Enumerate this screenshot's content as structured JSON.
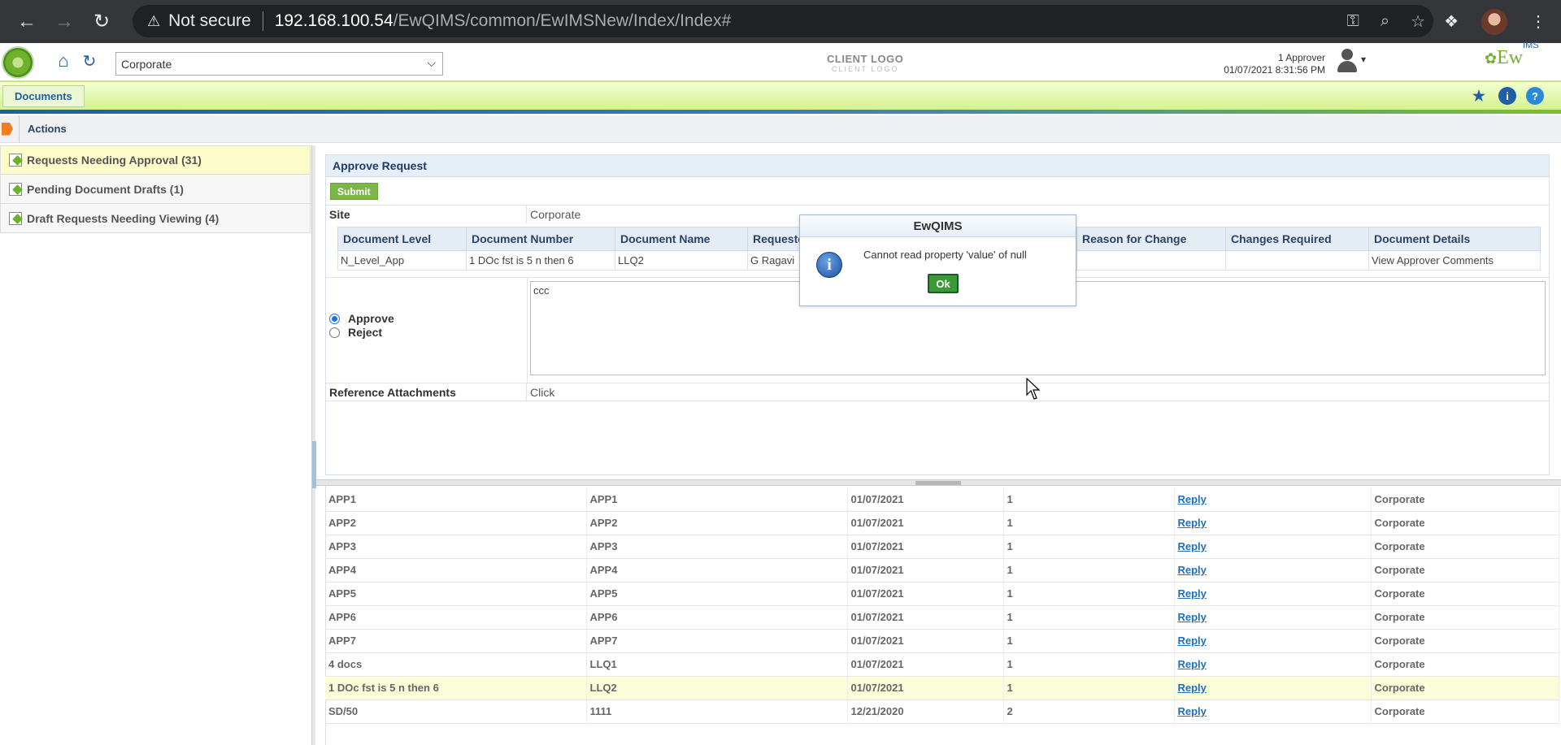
{
  "browser": {
    "not_secure_label": "Not secure",
    "url_host": "192.168.100.54",
    "url_path": "/EwQIMS/common/EwIMSNew/Index/Index#"
  },
  "header": {
    "site_selected": "Corporate",
    "client_logo": "CLIENT LOGO",
    "client_logo_mirror": "CLIENT LOGO",
    "user_role": "1 Approver",
    "datetime": "01/07/2021 8:31:56 PM",
    "brand_name": "EwQIMS",
    "brand_main": "Ew",
    "brand_sup": "IMS"
  },
  "nav": {
    "tab_label": "Documents",
    "info_label": "i",
    "help_label": "?"
  },
  "breadcrumb": {
    "label": "Actions"
  },
  "sidebar": {
    "items": [
      {
        "label": "Requests Needing Approval (31)"
      },
      {
        "label": "Pending Document Drafts (1)"
      },
      {
        "label": "Draft Requests Needing Viewing (4)"
      }
    ]
  },
  "panel": {
    "title": "Approve Request",
    "submit_label": "Submit",
    "site_label": "Site",
    "site_value": "Corporate",
    "table": {
      "headers": [
        "Document Level",
        "Document Number",
        "Document Name",
        "Requeste",
        "Reason for Change",
        "Changes Required",
        "Document Details"
      ],
      "row": [
        "N_Level_App",
        "1 DOc fst is 5 n then 6",
        "LLQ2",
        "G Ragavi",
        "",
        "",
        "View Approver Comments"
      ]
    },
    "approve_label": "Approve",
    "reject_label": "Reject",
    "comments_value": "ccc",
    "attachments_label": "Reference Attachments",
    "attachments_link": "Click"
  },
  "dialog": {
    "title": "EwQIMS",
    "icon_label": "i",
    "message": "Cannot read property 'value' of null",
    "ok_label": "Ok"
  },
  "grid": {
    "rows": [
      [
        "APP1",
        "APP1",
        "01/07/2021",
        "1",
        "Reply",
        "Corporate"
      ],
      [
        "APP2",
        "APP2",
        "01/07/2021",
        "1",
        "Reply",
        "Corporate"
      ],
      [
        "APP3",
        "APP3",
        "01/07/2021",
        "1",
        "Reply",
        "Corporate"
      ],
      [
        "APP4",
        "APP4",
        "01/07/2021",
        "1",
        "Reply",
        "Corporate"
      ],
      [
        "APP5",
        "APP5",
        "01/07/2021",
        "1",
        "Reply",
        "Corporate"
      ],
      [
        "APP6",
        "APP6",
        "01/07/2021",
        "1",
        "Reply",
        "Corporate"
      ],
      [
        "APP7",
        "APP7",
        "01/07/2021",
        "1",
        "Reply",
        "Corporate"
      ],
      [
        "4 docs",
        "LLQ1",
        "01/07/2021",
        "1",
        "Reply",
        "Corporate"
      ],
      [
        "1 DOc fst is 5 n then 6",
        "LLQ2",
        "01/07/2021",
        "1",
        "Reply",
        "Corporate"
      ],
      [
        "SD/50",
        "1111",
        "12/21/2020",
        "2",
        "Reply",
        "Corporate"
      ]
    ],
    "selected_row": 8
  },
  "colors": {
    "accent_blue": "#1f6fbf",
    "nav_green": "#d5f28d",
    "ok_green": "#3a9a3a",
    "selected_row": "#fbfcd8"
  },
  "icons": {
    "browser": [
      "back-icon",
      "forward-icon",
      "reload-icon",
      "warning-icon",
      "key-icon",
      "zoom-icon",
      "star-icon",
      "extensions-icon",
      "profile-icon",
      "menu-icon"
    ],
    "header": [
      "app-logo-icon",
      "home-icon",
      "refresh-icon",
      "chevron-down-icon",
      "user-icon"
    ],
    "nav": [
      "pin-icon",
      "info-icon",
      "help-icon"
    ],
    "dialog": [
      "info-icon"
    ]
  }
}
